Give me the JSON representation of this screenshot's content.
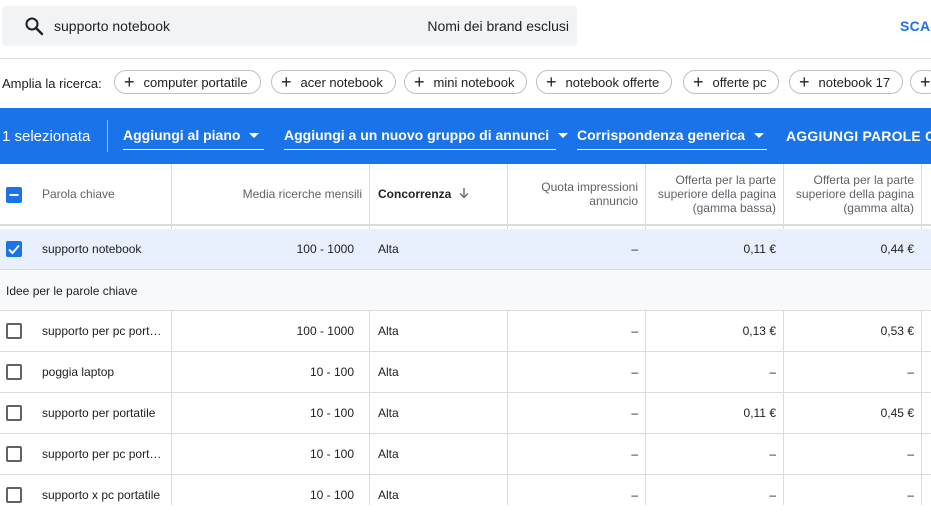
{
  "search": {
    "query": "supporto notebook",
    "excluded_brands_label": "Nomi dei brand esclusi",
    "download_label": "SCAI"
  },
  "expand": {
    "label": "Amplia la ricerca:",
    "chips": [
      "computer portatile",
      "acer notebook",
      "mini notebook",
      "notebook offerte",
      "offerte pc",
      "notebook 17"
    ]
  },
  "toolbar": {
    "selected_count": "1 selezionata",
    "add_to_plan": "Aggiungi al piano",
    "add_to_new_group": "Aggiungi a un nuovo gruppo di annunci",
    "match_type": "Corrispondenza generica",
    "add_keywords": "AGGIUNGI PAROLE CH"
  },
  "columns": {
    "keyword": "Parola chiave",
    "monthly_searches": "Media ricerche mensili",
    "competition": "Concorrenza",
    "impression_share": "Quota impressioni annuncio",
    "bid_low": "Offerta per la parte superiore della pagina (gamma bassa)",
    "bid_high": "Offerta per la parte superiore della pagina (gamma alta)"
  },
  "selected_row": {
    "keyword": "supporto notebook",
    "monthly": "100 - 1000",
    "competition": "Alta",
    "share": "–",
    "low": "0,11 €",
    "high": "0,44 €"
  },
  "ideas_section_label": "Idee per le parole chiave",
  "rows": [
    {
      "keyword": "supporto per pc port…",
      "monthly": "100 - 1000",
      "competition": "Alta",
      "share": "–",
      "low": "0,13 €",
      "high": "0,53 €"
    },
    {
      "keyword": "poggia laptop",
      "monthly": "10 - 100",
      "competition": "Alta",
      "share": "–",
      "low": "–",
      "high": "–"
    },
    {
      "keyword": "supporto per portatile",
      "monthly": "10 - 100",
      "competition": "Alta",
      "share": "–",
      "low": "0,11 €",
      "high": "0,45 €"
    },
    {
      "keyword": "supporto per pc port…",
      "monthly": "10 - 100",
      "competition": "Alta",
      "share": "–",
      "low": "–",
      "high": "–"
    },
    {
      "keyword": "supporto x pc portatile",
      "monthly": "10 - 100",
      "competition": "Alta",
      "share": "–",
      "low": "–",
      "high": "–"
    }
  ],
  "icons": {
    "search": "search-icon",
    "sort": "arrow-down-icon",
    "checkbox": "checkbox-icon",
    "plus": "plus-icon",
    "caret": "caret-down-icon"
  }
}
